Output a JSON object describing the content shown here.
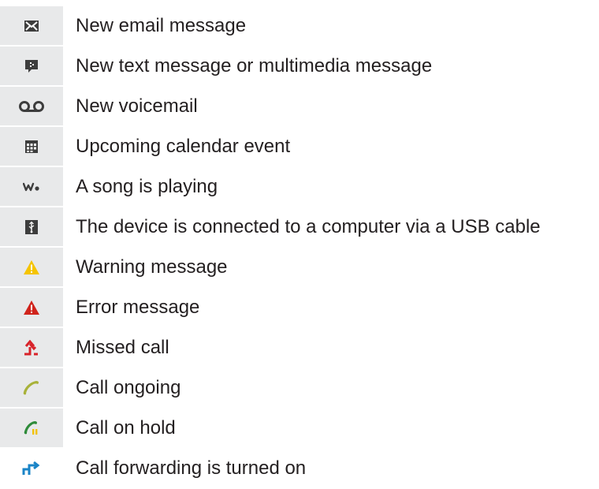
{
  "items": [
    {
      "icon": "email-icon",
      "label": "New email message"
    },
    {
      "icon": "text-message-icon",
      "label": "New text message or multimedia message"
    },
    {
      "icon": "voicemail-icon",
      "label": "New voicemail"
    },
    {
      "icon": "calendar-icon",
      "label": "Upcoming calendar event"
    },
    {
      "icon": "walkman-icon",
      "label": "A song is playing"
    },
    {
      "icon": "usb-icon",
      "label": "The device is connected to a computer via a USB cable"
    },
    {
      "icon": "warning-icon",
      "label": "Warning message"
    },
    {
      "icon": "error-icon",
      "label": "Error message"
    },
    {
      "icon": "missed-call-icon",
      "label": "Missed call"
    },
    {
      "icon": "call-ongoing-icon",
      "label": "Call ongoing"
    },
    {
      "icon": "call-on-hold-icon",
      "label": "Call on hold"
    },
    {
      "icon": "call-forwarding-icon",
      "label": "Call forwarding is turned on"
    }
  ],
  "colors": {
    "icon_gray": "#3d3d3d",
    "warning_yellow": "#f5c400",
    "error_red": "#d0241c",
    "missed_red": "#d8232a",
    "call_green": "#a8b23a",
    "hold_green": "#2e8b3a",
    "hold_yellow": "#f2c200",
    "forward_blue": "#1a84c7"
  }
}
